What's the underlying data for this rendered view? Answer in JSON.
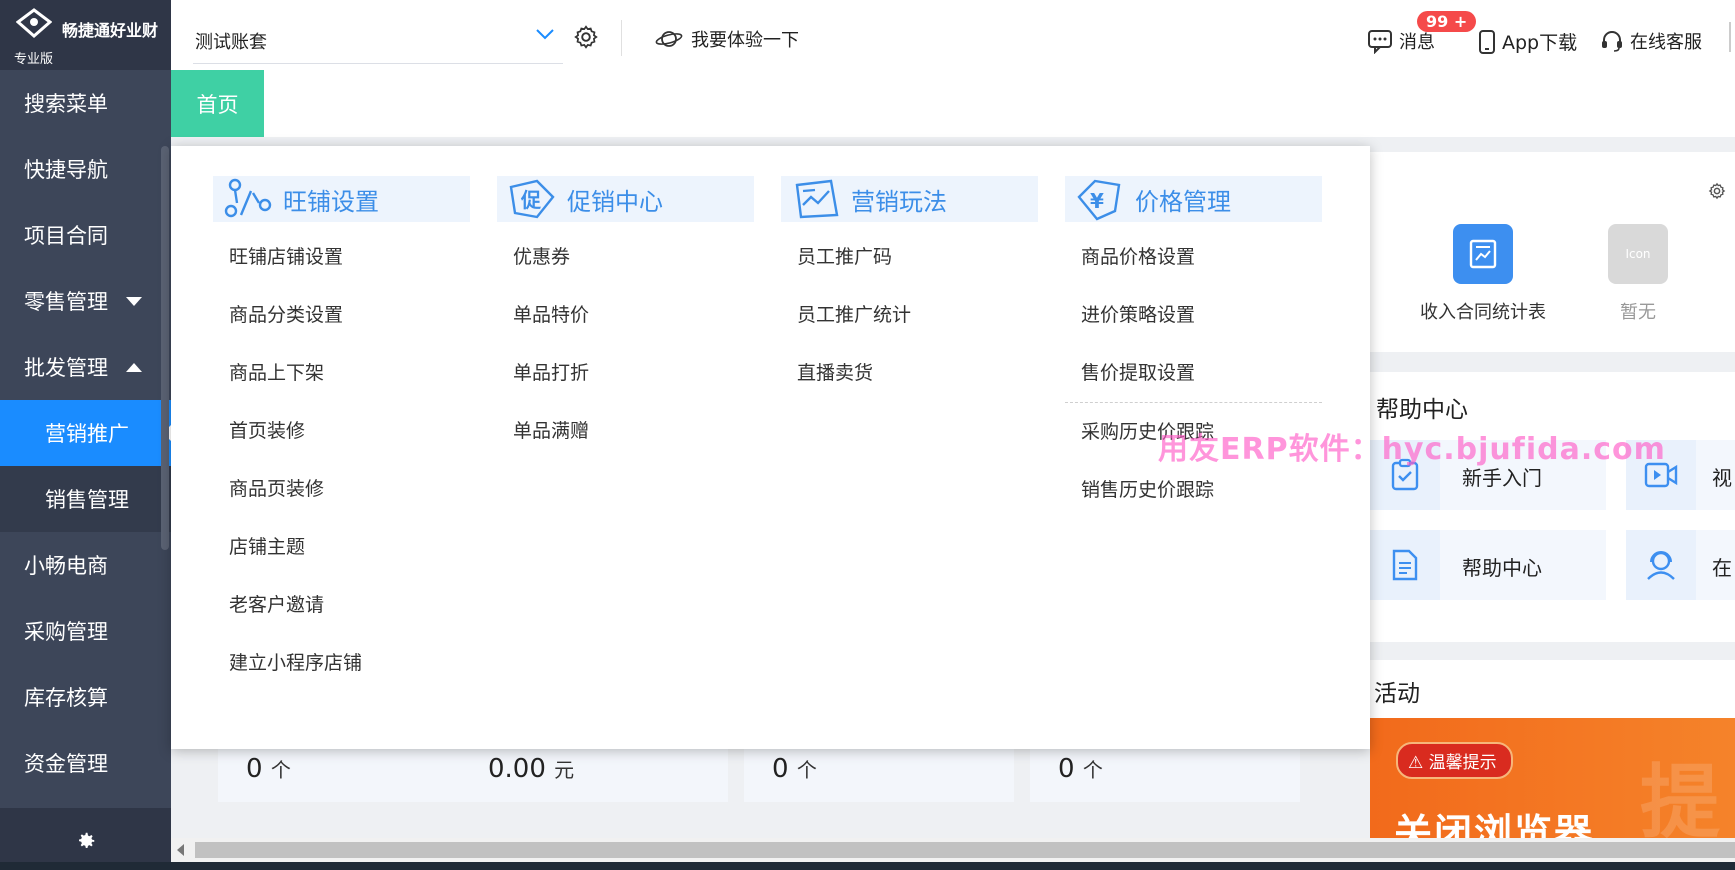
{
  "brand": {
    "name": "畅捷通好业财",
    "edition": "专业版"
  },
  "sidebar": {
    "items": [
      {
        "label": "搜索菜单"
      },
      {
        "label": "快捷导航"
      },
      {
        "label": "项目合同"
      },
      {
        "label": "零售管理"
      },
      {
        "label": "批发管理"
      },
      {
        "label": "营销推广"
      },
      {
        "label": "销售管理"
      },
      {
        "label": "小畅电商"
      },
      {
        "label": "采购管理"
      },
      {
        "label": "库存核算"
      },
      {
        "label": "资金管理"
      }
    ]
  },
  "header": {
    "account": "测试账套",
    "try_label": "我要体验一下",
    "messages_label": "消息",
    "messages_badge": "99 +",
    "app_label": "App下载",
    "service_label": "在线客服"
  },
  "tabs": [
    {
      "label": "首页"
    }
  ],
  "menu": {
    "columns": [
      {
        "title": "旺铺设置",
        "items": [
          "旺铺店铺设置",
          "商品分类设置",
          "商品上下架",
          "首页装修",
          "商品页装修",
          "店铺主题",
          "老客户邀请",
          "建立小程序店铺"
        ]
      },
      {
        "title": "促销中心",
        "items": [
          "优惠券",
          "单品特价",
          "单品打折",
          "单品满赠"
        ]
      },
      {
        "title": "营销玩法",
        "items": [
          "员工推广码",
          "员工推广统计",
          "直播卖货"
        ]
      },
      {
        "title": "价格管理",
        "items": [
          "商品价格设置",
          "进价策略设置",
          "售价提取设置"
        ],
        "items2": [
          "采购历史价跟踪",
          "销售历史价跟踪"
        ]
      }
    ]
  },
  "stats": [
    {
      "value": "0",
      "unit": "个"
    },
    {
      "value": "0.00",
      "unit": "元"
    },
    {
      "value": "0",
      "unit": "个"
    },
    {
      "value": "0",
      "unit": "个"
    }
  ],
  "right": {
    "apps": [
      {
        "label": "收入合同统计表"
      },
      {
        "label": "暂无",
        "icon_text": "Icon"
      }
    ],
    "help_title": "帮助中心",
    "help_cards": [
      {
        "label": "新手入门"
      },
      {
        "label": "帮助中心"
      }
    ],
    "help_cards_cut": [
      {
        "label": "视"
      },
      {
        "label": "在"
      }
    ],
    "activity_title": "活动",
    "activity_pill": "温馨提示",
    "activity_text": "关闭浏览器",
    "activity_deco": "提"
  },
  "watermark": "用友ERP软件：hyc.bjufida.com",
  "colors": {
    "accent": "#1a8cff",
    "tab_active": "#3fd0a4",
    "sidebar": "#3d4659",
    "menu_head": "#3c8ee8",
    "badge": "#f54a4a"
  }
}
